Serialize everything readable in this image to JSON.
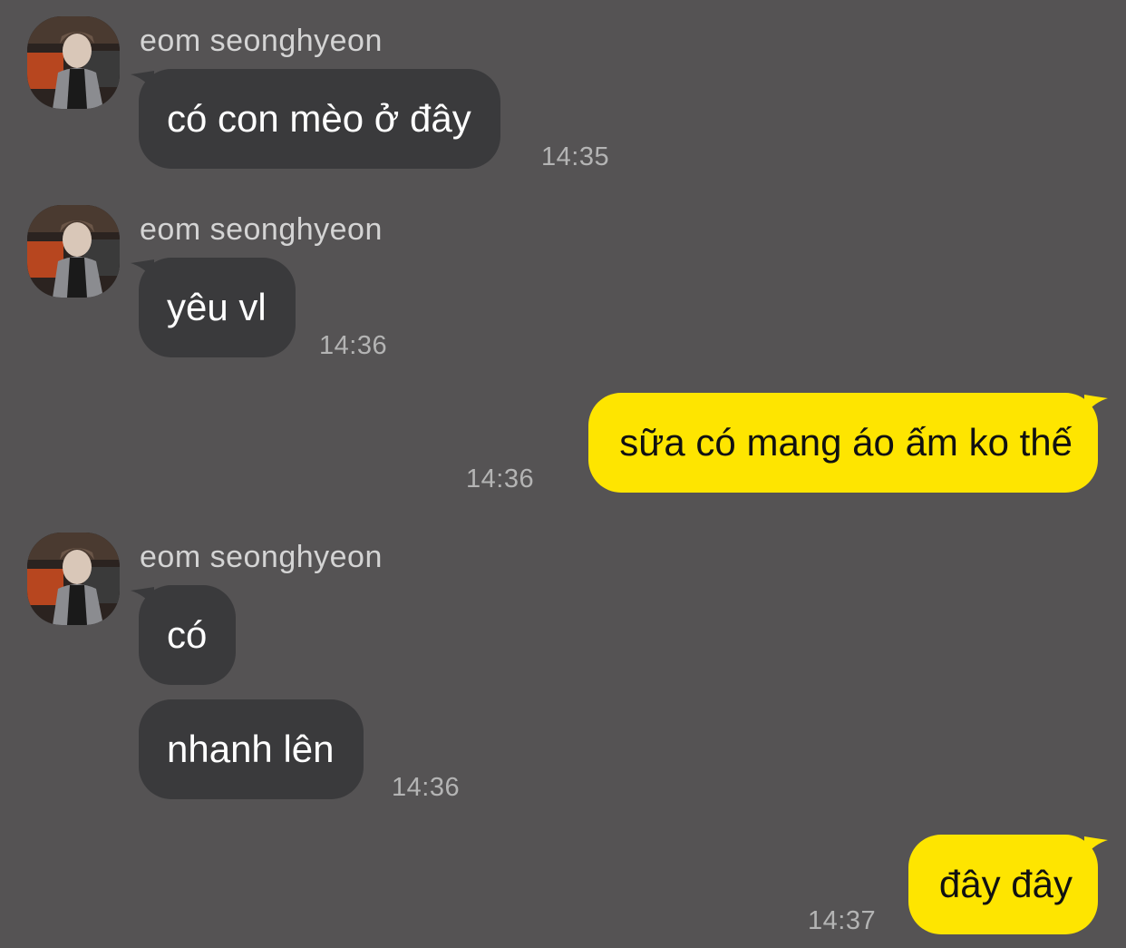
{
  "messages": [
    {
      "sender": "eom seonghyeon",
      "text": "có con mèo ở đây",
      "time": "14:35"
    },
    {
      "sender": "eom seonghyeon",
      "text": "yêu vl",
      "time": "14:36"
    },
    {
      "text": "sữa có mang áo ấm ko thế",
      "time": "14:36"
    },
    {
      "sender": "eom seonghyeon",
      "text": "có"
    },
    {
      "text": "nhanh lên",
      "time": "14:36"
    },
    {
      "text": "đây đây",
      "time": "14:37"
    }
  ],
  "colors": {
    "background": "#555354",
    "incoming_bubble": "#3a3a3c",
    "outgoing_bubble": "#fee500"
  },
  "icons": {
    "avatar": "profile-photo"
  }
}
